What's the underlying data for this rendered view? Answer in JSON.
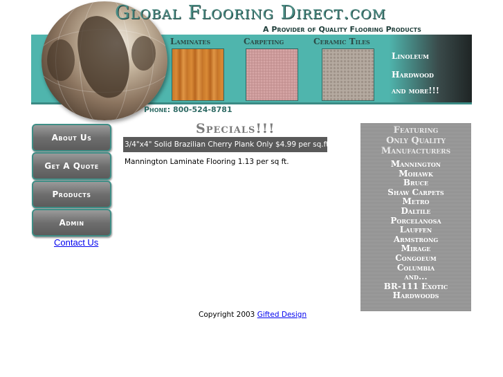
{
  "header": {
    "title": "Global Flooring Direct.com",
    "tagline": "A Provider of Quality Flooring Products",
    "phone": "Phone: 800-524-8781",
    "categories": [
      "Laminates",
      "Carpeting",
      "Ceramic Tiles"
    ],
    "more_categories": [
      "Linoleum",
      "Hardwood",
      "and more!!!"
    ]
  },
  "nav": {
    "buttons": [
      "About Us",
      "Get A Quote",
      "Products",
      "Admin"
    ],
    "contact_link": "Contact Us"
  },
  "specials": {
    "heading": "Specials!!!",
    "items": [
      "3/4\"x4\" Solid Brazilian Cherry Plank Only $4.99 per sq.ft",
      "Mannington Laminate Flooring 1.13 per sq ft."
    ]
  },
  "manufacturers": {
    "heading": [
      "Featuring",
      "Only Quality",
      "Manufacturers"
    ],
    "items": [
      "Mannington",
      "Mohawk",
      "Bruce",
      "Shaw Carpets",
      "Metro",
      "Daltile",
      "Porcelanosa",
      "Lauffen",
      "Armstrong",
      "Mirage",
      "Congoeum",
      "Columbia",
      "and...",
      "BR-111 Exotic",
      "Hardwoods"
    ]
  },
  "footer": {
    "copyright": "Copyright 2003",
    "designer_link": "Gifted Design"
  }
}
